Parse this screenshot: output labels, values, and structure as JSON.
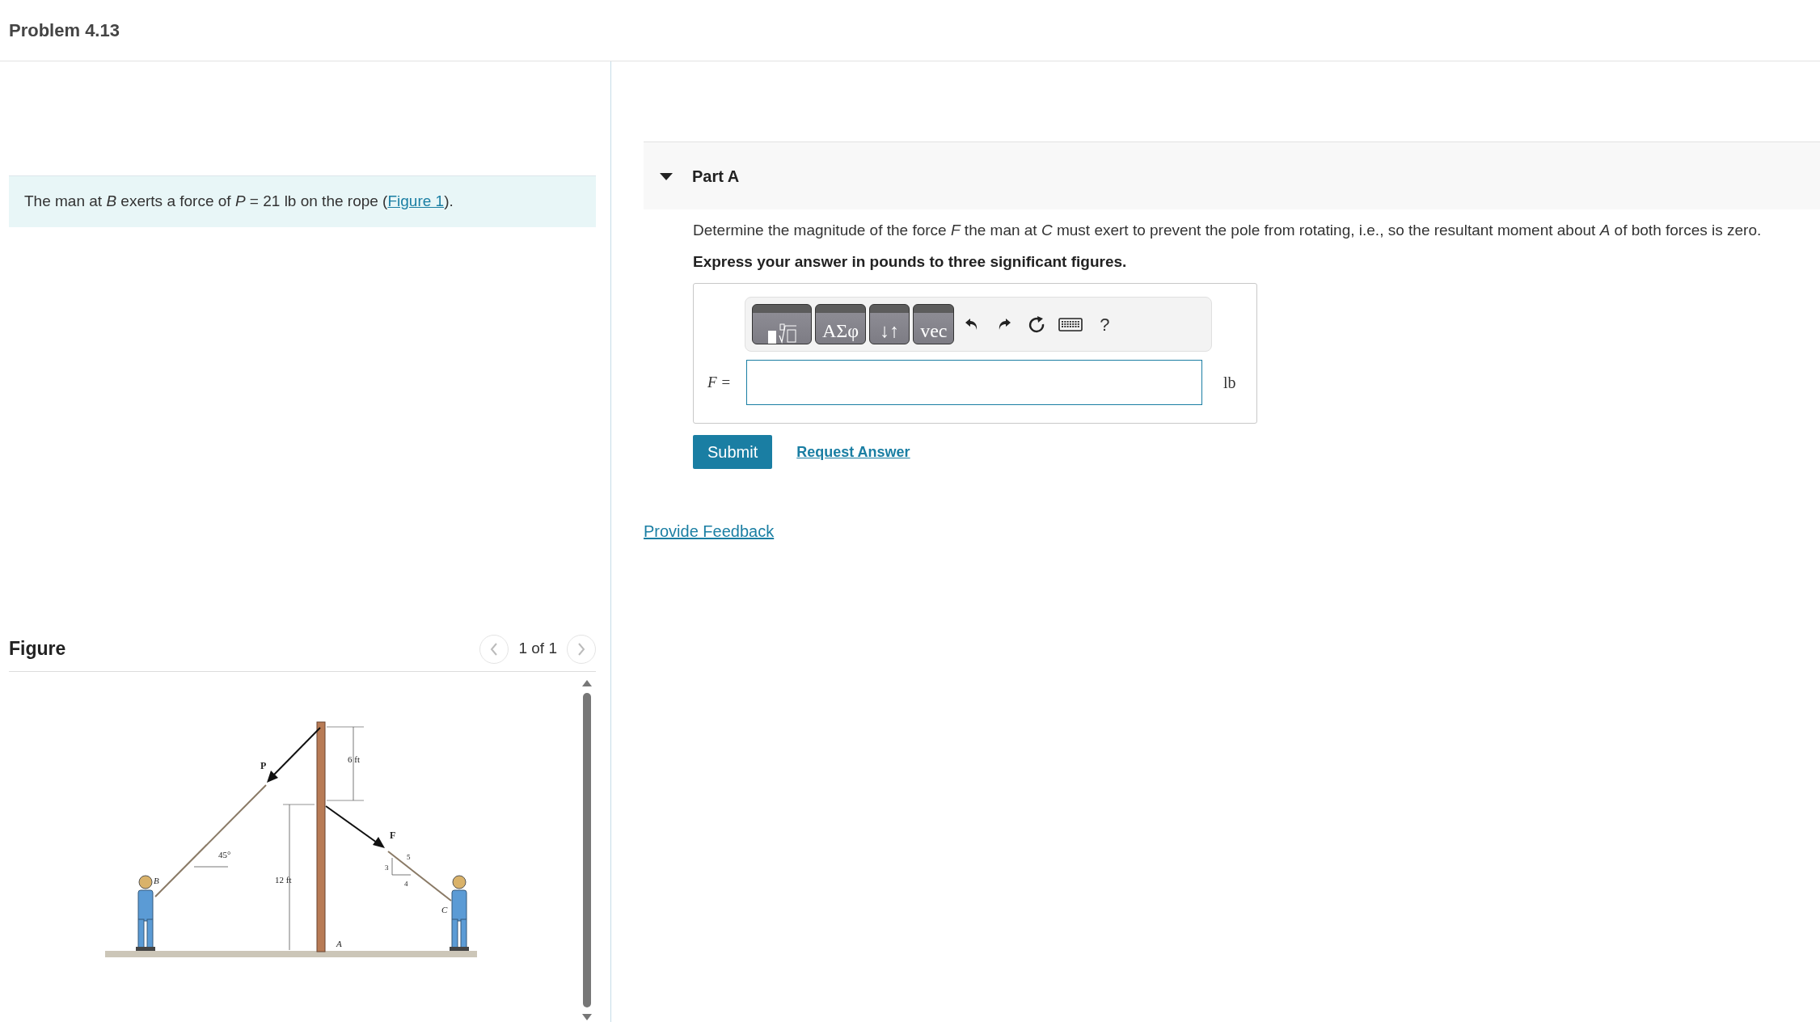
{
  "header": {
    "title": "Problem 4.13"
  },
  "intro": {
    "text_before": "The man at *B* exerts a force of *P* = 21 lb on the rope (",
    "link": "Figure 1",
    "text_after": ")."
  },
  "figure": {
    "heading": "Figure",
    "pager": "1 of 1",
    "labels": [
      {
        "kind": "force",
        "text": "P"
      },
      {
        "kind": "dimension",
        "text": "6 ft"
      },
      {
        "kind": "force",
        "text": "F"
      },
      {
        "kind": "angle",
        "text": "45°"
      },
      {
        "kind": "point",
        "text": "B"
      },
      {
        "kind": "dimension",
        "text": "12 ft"
      },
      {
        "kind": "slope",
        "text": "5"
      },
      {
        "kind": "slope",
        "text": "3"
      },
      {
        "kind": "slope",
        "text": "4"
      },
      {
        "kind": "point",
        "text": "C"
      },
      {
        "kind": "point",
        "text": "A"
      }
    ]
  },
  "part": {
    "title": "Part A",
    "expanded": true,
    "question": "Determine the magnitude of the force *F* the man at *C* must exert to prevent the pole from rotating, i.e., so the resultant moment about *A* of both forces is zero.",
    "instruction": "Express your answer in pounds to three significant figures.",
    "toolbar": [
      {
        "kind": "template"
      },
      {
        "kind": "palette",
        "label": "ΑΣφ"
      },
      {
        "kind": "palette",
        "label": "↓↑"
      },
      {
        "kind": "palette",
        "label": "vec"
      },
      {
        "kind": "undo"
      },
      {
        "kind": "redo"
      },
      {
        "kind": "reset"
      },
      {
        "kind": "keyboard"
      },
      {
        "kind": "help",
        "label": "?"
      }
    ],
    "answer_label": "F =",
    "unit": "lb",
    "submit": "Submit",
    "request": "Request Answer"
  },
  "feedback": "Provide Feedback"
}
